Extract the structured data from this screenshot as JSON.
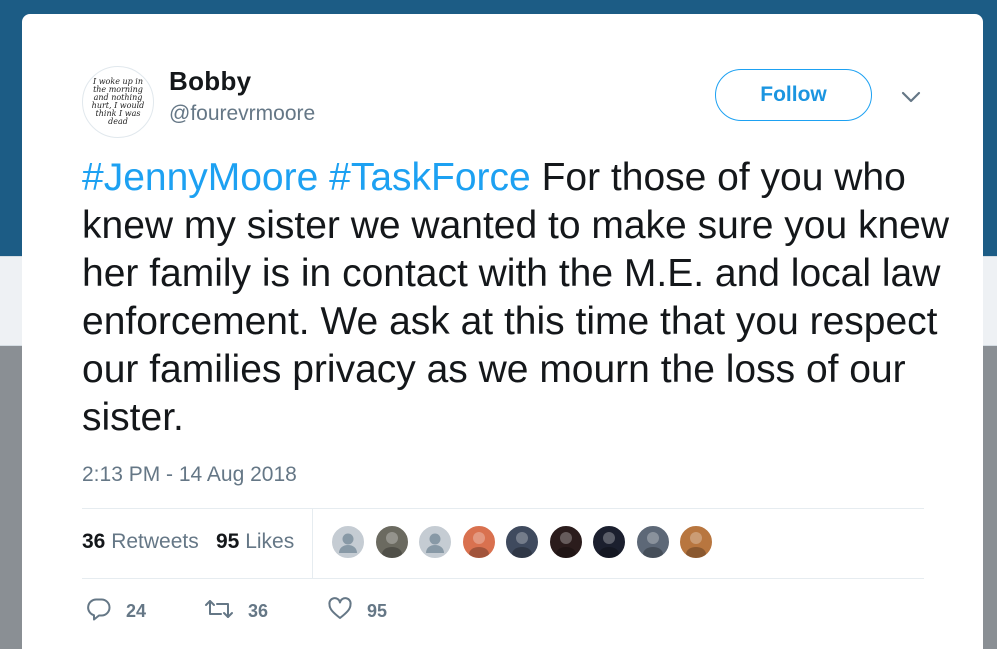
{
  "tweet": {
    "author_name": "Bobby",
    "author_handle": "@fourevrmoore",
    "avatar_text": "I woke up in the morning and nothing hurt, I would think I was dead",
    "follow_label": "Follow",
    "hashtag_1": "#JennyMoore",
    "hashtag_2": "#TaskForce",
    "body": "For those of you who knew my sister we wanted to make sure you knew her family is in contact with the M.E. and local law enforcement. We ask at this time that you respect our families privacy as we mourn the loss of our sister.",
    "timestamp": "2:13 PM - 14 Aug 2018"
  },
  "stats": {
    "retweets_count": "36",
    "retweets_label": "Retweets",
    "likes_count": "95",
    "likes_label": "Likes"
  },
  "likers": [
    {
      "name": "liker-1",
      "color": "#c5ccd3",
      "kind": "default"
    },
    {
      "name": "liker-2",
      "color": "#6b6a60",
      "kind": "photo"
    },
    {
      "name": "liker-3",
      "color": "#c5ccd3",
      "kind": "default"
    },
    {
      "name": "liker-4",
      "color": "#d9714f",
      "kind": "photo"
    },
    {
      "name": "liker-5",
      "color": "#3f4a5e",
      "kind": "photo"
    },
    {
      "name": "liker-6",
      "color": "#2b1c1c",
      "kind": "photo"
    },
    {
      "name": "liker-7",
      "color": "#1b1f2e",
      "kind": "photo"
    },
    {
      "name": "liker-8",
      "color": "#5d6877",
      "kind": "photo"
    },
    {
      "name": "liker-9",
      "color": "#b8763f",
      "kind": "photo"
    }
  ],
  "actions": {
    "reply_count": "24",
    "retweet_count": "36",
    "like_count": "95",
    "reply_icon": "reply-icon",
    "retweet_icon": "retweet-icon",
    "like_icon": "heart-icon"
  },
  "colors": {
    "accent": "#1da1f2",
    "text": "#14171a",
    "muted": "#657786"
  }
}
